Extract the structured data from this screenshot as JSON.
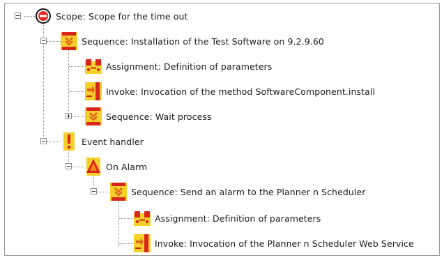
{
  "icons": {
    "scope": "scope-icon",
    "sequence": "sequence-icon",
    "assignment": "assignment-icon",
    "invoke": "invoke-icon",
    "event": "event-handler-icon",
    "alarm": "alarm-icon"
  },
  "colors": {
    "icon_yellow": "#f7d32a",
    "icon_red": "#d9261c",
    "icon_orange": "#f28a1a",
    "tree_line": "#8c8c8c"
  },
  "tree": {
    "scope": {
      "label": "Scope: Scope for the time out",
      "expanded": true
    },
    "sequence_install": {
      "label": "Sequence: Installation of the Test Software on 9.2.9.60",
      "expanded": true
    },
    "assignment_1": {
      "label": "Assignment: Definition of parameters"
    },
    "invoke_1": {
      "label": "Invoke: Invocation of the method SoftwareComponent.install"
    },
    "sequence_wait": {
      "label": "Sequence: Wait process",
      "expanded": false
    },
    "event_handler": {
      "label": "Event handler",
      "expanded": true
    },
    "on_alarm": {
      "label": "On Alarm",
      "expanded": true
    },
    "sequence_alarm": {
      "label": "Sequence: Send an alarm to the Planner n Scheduler",
      "expanded": true
    },
    "assignment_2": {
      "label": "Assignment: Definition of parameters"
    },
    "invoke_2": {
      "label": "Invoke: Invocation of the Planner n Scheduler Web Service"
    }
  }
}
